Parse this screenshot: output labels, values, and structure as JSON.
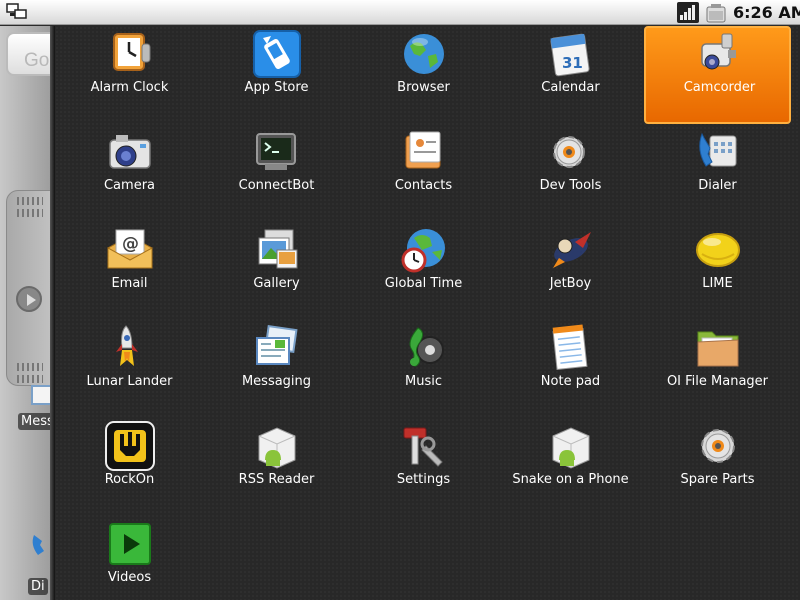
{
  "status_bar": {
    "time": "6:26 AM",
    "icons": [
      "network-icon",
      "signal-icon",
      "battery-icon"
    ]
  },
  "home": {
    "search_hint": "Go",
    "labels": [
      "Mess",
      "Di"
    ]
  },
  "drawer": {
    "selected": "Camcorder",
    "accent_color": "#ff8c00",
    "apps": [
      {
        "label": "Alarm Clock",
        "icon": "alarm-clock-icon"
      },
      {
        "label": "App Store",
        "icon": "app-store-icon"
      },
      {
        "label": "Browser",
        "icon": "globe-icon"
      },
      {
        "label": "Calendar",
        "icon": "calendar-icon",
        "icon_text": "31"
      },
      {
        "label": "Camcorder",
        "icon": "camcorder-icon"
      },
      {
        "label": "Camera",
        "icon": "camera-icon"
      },
      {
        "label": "ConnectBot",
        "icon": "terminal-icon"
      },
      {
        "label": "Contacts",
        "icon": "contacts-icon"
      },
      {
        "label": "Dev Tools",
        "icon": "gear-icon"
      },
      {
        "label": "Dialer",
        "icon": "phone-icon"
      },
      {
        "label": "Email",
        "icon": "email-icon",
        "icon_text": "@"
      },
      {
        "label": "Gallery",
        "icon": "gallery-icon"
      },
      {
        "label": "Global Time",
        "icon": "globe-clock-icon"
      },
      {
        "label": "JetBoy",
        "icon": "jetboy-icon"
      },
      {
        "label": "LIME",
        "icon": "lime-icon"
      },
      {
        "label": "Lunar Lander",
        "icon": "rocket-icon"
      },
      {
        "label": "Messaging",
        "icon": "messaging-icon"
      },
      {
        "label": "Music",
        "icon": "music-icon"
      },
      {
        "label": "Note pad",
        "icon": "notepad-icon"
      },
      {
        "label": "OI File Manager",
        "icon": "folder-icon"
      },
      {
        "label": "RockOn",
        "icon": "rockon-icon"
      },
      {
        "label": "RSS Reader",
        "icon": "android-box-icon"
      },
      {
        "label": "Settings",
        "icon": "settings-icon"
      },
      {
        "label": "Snake on a Phone",
        "icon": "android-box-icon"
      },
      {
        "label": "Spare Parts",
        "icon": "gear-icon"
      },
      {
        "label": "Videos",
        "icon": "play-icon"
      }
    ]
  }
}
